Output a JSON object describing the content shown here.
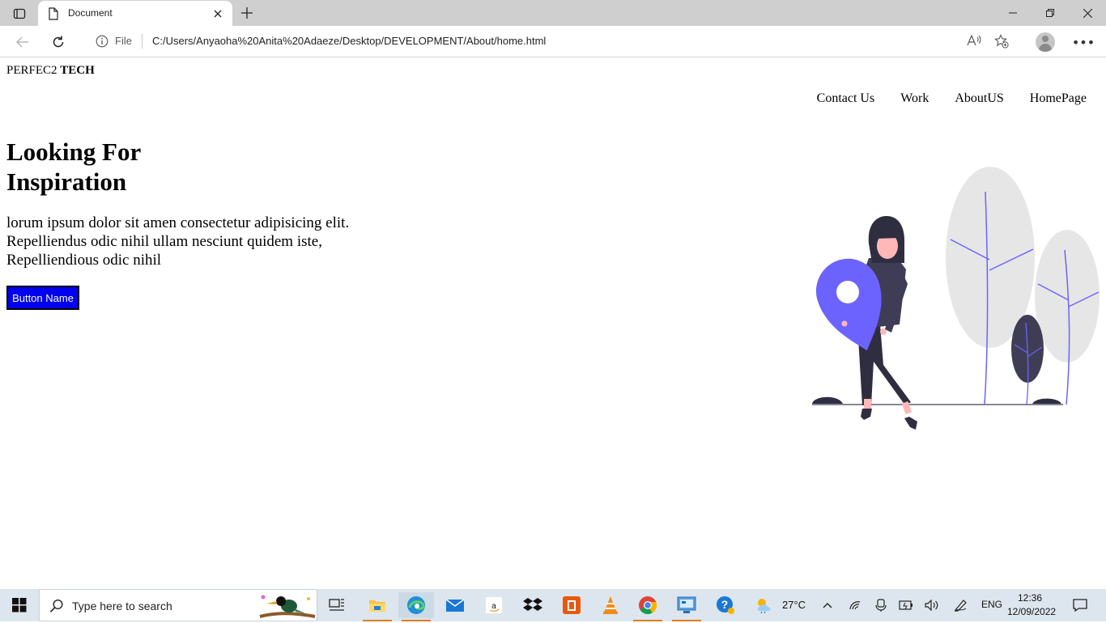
{
  "browser": {
    "tab_title": "Document",
    "address": {
      "scheme_label": "File",
      "url": "C:/Users/Anyaoha%20Anita%20Adaeze/Desktop/DEVELOPMENT/About/home.html"
    }
  },
  "page": {
    "logo": {
      "part1": "PERFEC2",
      "part2": "TECH"
    },
    "nav": [
      "Contact Us",
      "Work",
      "AboutUS",
      "HomePage"
    ],
    "hero": {
      "title_line1": "Looking For",
      "title_line2": "Inspiration",
      "text_line1": "lorum ipsum dolor sit amen consectetur adipisicing elit.",
      "text_line2": "Repelliendus odic nihil ullam nesciunt quidem iste,",
      "text_line3": "Repelliendious odic nihil",
      "button": "Button Name"
    },
    "colors": {
      "accent": "#6c63ff",
      "button_bg": "#0000ee",
      "dark": "#2f2e41",
      "tree": "#e6e6e6",
      "skin": "#ffb8b8"
    }
  },
  "taskbar": {
    "search_placeholder": "Type here to search",
    "weather": "27°C",
    "language": "ENG",
    "time": "12:36",
    "date": "12/09/2022",
    "icons": [
      "task-view-icon",
      "file-explorer-icon",
      "edge-icon",
      "mail-icon",
      "amazon-icon",
      "dropbox-icon",
      "office-icon",
      "vlc-icon",
      "chrome-icon",
      "control-panel-icon",
      "help-icon"
    ]
  }
}
